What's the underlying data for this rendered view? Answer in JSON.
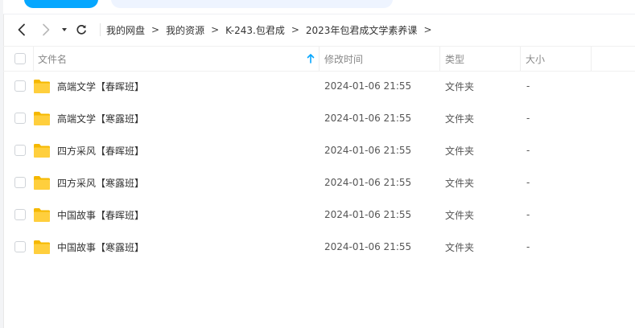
{
  "breadcrumb": [
    {
      "label": "我的网盘"
    },
    {
      "label": "我的资源"
    },
    {
      "label": "K-243.包君成"
    },
    {
      "label": "2023年包君成文学素养课"
    }
  ],
  "breadcrumb_separator": ">",
  "table": {
    "headers": {
      "name": "文件名",
      "modified": "修改时间",
      "type": "类型",
      "size": "大小"
    },
    "rows": [
      {
        "name": "高端文学【春晖班】",
        "modified": "2024-01-06 21:55",
        "type": "文件夹",
        "size": "-"
      },
      {
        "name": "高端文学【寒露班】",
        "modified": "2024-01-06 21:55",
        "type": "文件夹",
        "size": "-"
      },
      {
        "name": "四方采风【春晖班】",
        "modified": "2024-01-06 21:55",
        "type": "文件夹",
        "size": "-"
      },
      {
        "name": "四方采风【寒露班】",
        "modified": "2024-01-06 21:55",
        "type": "文件夹",
        "size": "-"
      },
      {
        "name": "中国故事【春晖班】",
        "modified": "2024-01-06 21:55",
        "type": "文件夹",
        "size": "-"
      },
      {
        "name": "中国故事【寒露班】",
        "modified": "2024-01-06 21:55",
        "type": "文件夹",
        "size": "-"
      }
    ]
  },
  "icons": {
    "back": "chevron-left-icon",
    "forward": "chevron-right-icon",
    "history": "caret-down-icon",
    "refresh": "refresh-icon",
    "sort": "sort-ascending-icon",
    "folder": "folder-icon"
  },
  "colors": {
    "accent": "#06a7ff",
    "folder": "#ffc933",
    "pill_light": "#eef4ff"
  }
}
